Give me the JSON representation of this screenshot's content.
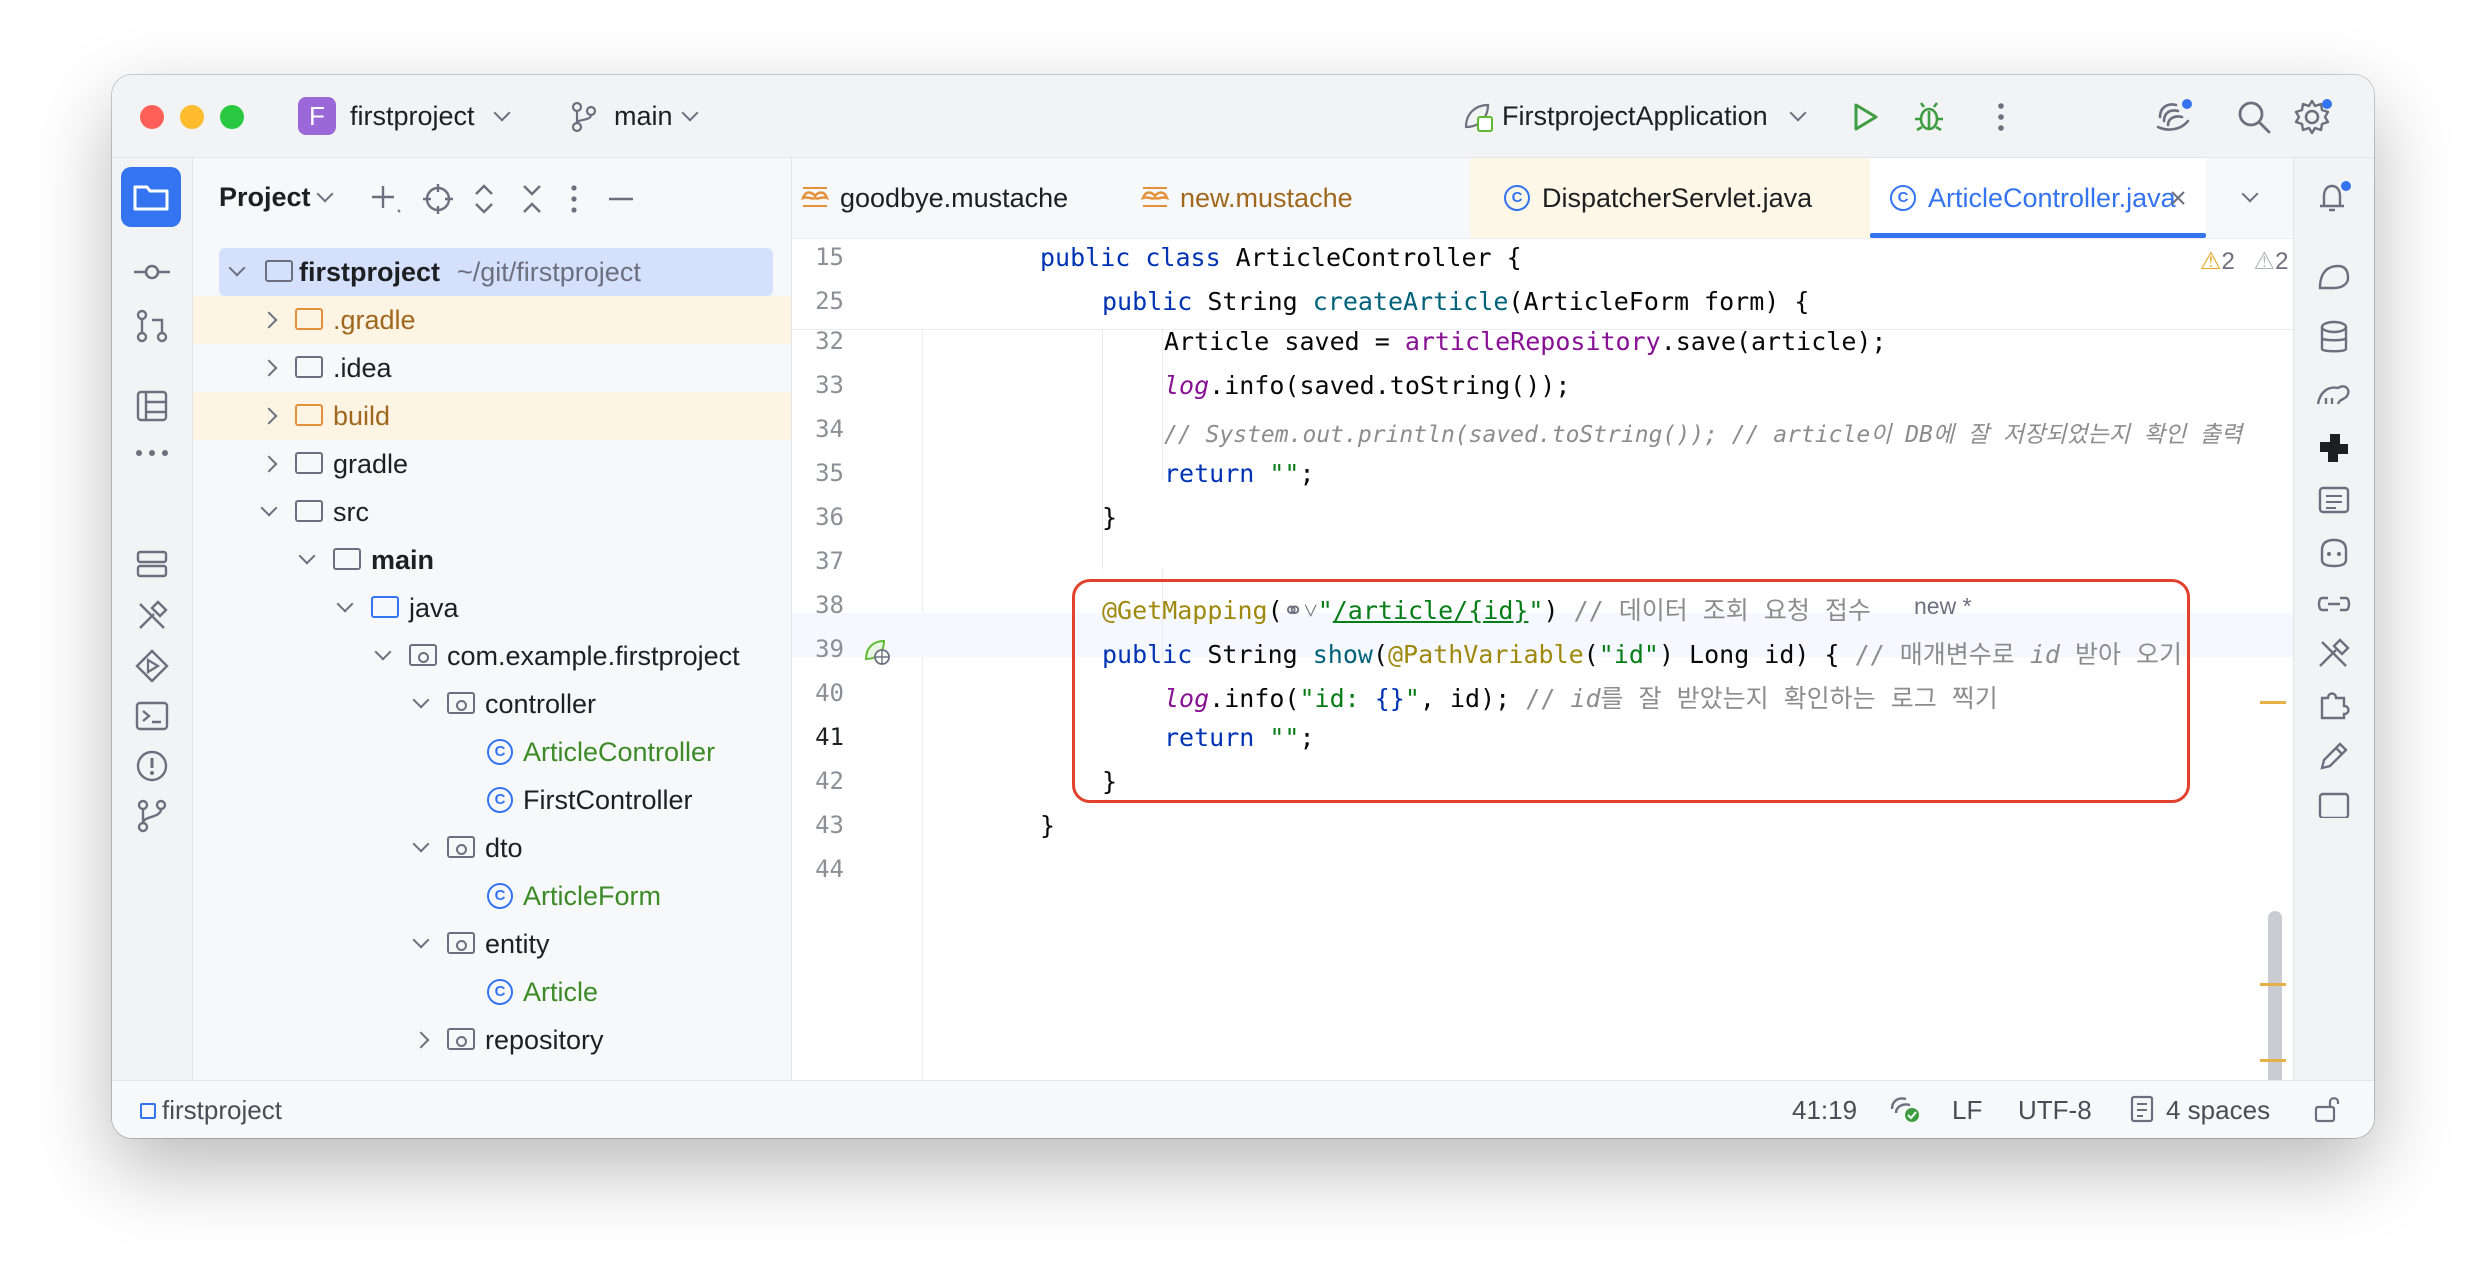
{
  "titlebar": {
    "project_badge": "F",
    "project_name": "firstproject",
    "branch": "main",
    "run_config": "FirstprojectApplication"
  },
  "project_panel": {
    "title": "Project",
    "tree": [
      {
        "label": "firstproject",
        "path": "~/git/firstproject"
      },
      {
        "label": ".gradle"
      },
      {
        "label": ".idea"
      },
      {
        "label": "build"
      },
      {
        "label": "gradle"
      },
      {
        "label": "src"
      },
      {
        "label": "main"
      },
      {
        "label": "java"
      },
      {
        "label": "com.example.firstproject"
      },
      {
        "label": "controller"
      },
      {
        "label": "ArticleController"
      },
      {
        "label": "FirstController"
      },
      {
        "label": "dto"
      },
      {
        "label": "ArticleForm"
      },
      {
        "label": "entity"
      },
      {
        "label": "Article"
      },
      {
        "label": "repository"
      }
    ]
  },
  "tabs": [
    {
      "label": "goodbye.mustache"
    },
    {
      "label": "new.mustache"
    },
    {
      "label": "DispatcherServlet.java"
    },
    {
      "label": "ArticleController.java"
    }
  ],
  "editor": {
    "warnings": [
      "2",
      "2"
    ],
    "sticky": [
      {
        "ln": "15",
        "text": "public class ArticleController {"
      },
      {
        "ln": "25",
        "text": "public String createArticle(ArticleForm form) {"
      }
    ],
    "lines": [
      {
        "ln": "32",
        "text": "Article saved = articleRepository.save(article);"
      },
      {
        "ln": "33",
        "text": "log.info(saved.toString());"
      },
      {
        "ln": "34",
        "text": "// System.out.println(saved.toString()); // article이 DB에 잘 저장되었는지 확인 출력"
      },
      {
        "ln": "35",
        "text": "return \"\";"
      },
      {
        "ln": "36",
        "text": "}"
      },
      {
        "ln": "37",
        "text": ""
      },
      {
        "ln": "38",
        "text": "@GetMapping(\"/article/{id}\") // 데이터 조회 요청 접수"
      },
      {
        "ln": "39",
        "text": "public String show(@PathVariable(\"id\") Long id) { // 매개변수로 id 받아 오기"
      },
      {
        "ln": "40",
        "text": "log.info(\"id: {}\", id); // id를 잘 받았는지 확인하는 로그 찍기"
      },
      {
        "ln": "41",
        "text": "return \"\";"
      },
      {
        "ln": "42",
        "text": "}"
      },
      {
        "ln": "43",
        "text": "}"
      },
      {
        "ln": "44",
        "text": ""
      }
    ],
    "inlay_hint": "new *"
  },
  "statusbar": {
    "project": "firstproject",
    "position": "41:19",
    "line_ending": "LF",
    "encoding": "UTF-8",
    "indent": "4 spaces"
  }
}
